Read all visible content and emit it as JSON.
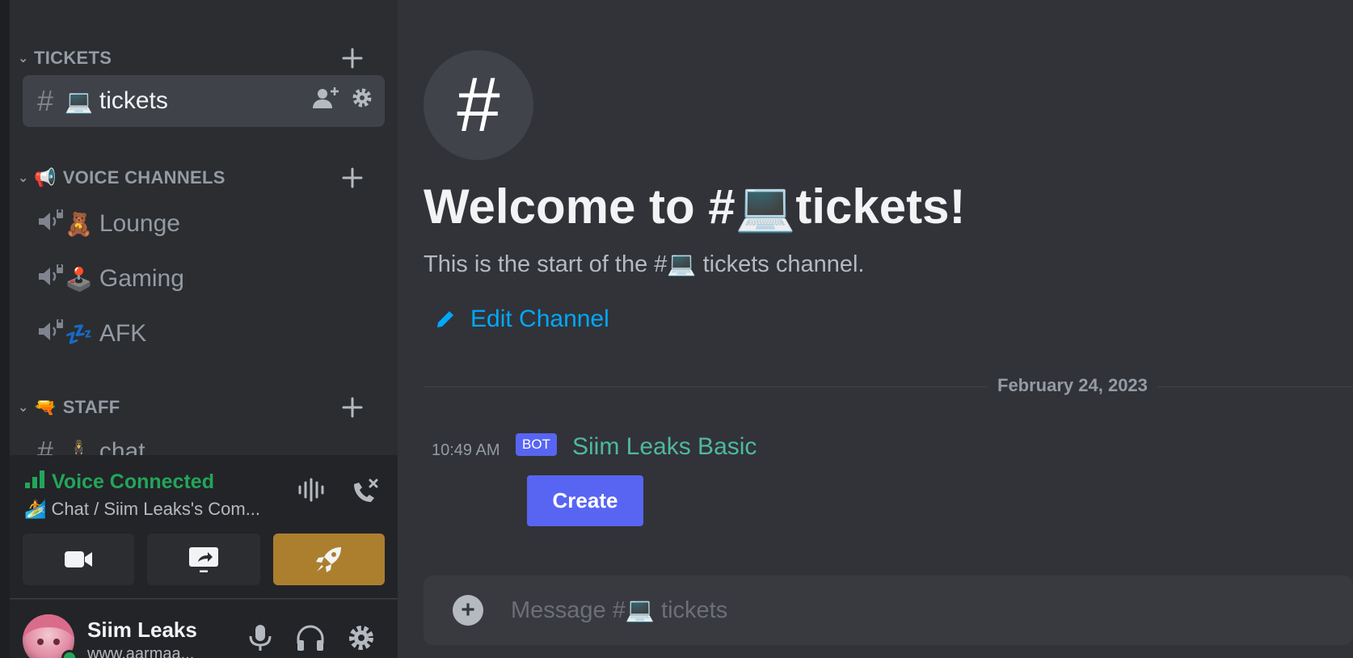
{
  "sidebar": {
    "categories": [
      {
        "label": "TICKETS",
        "emoji": ""
      },
      {
        "label": "VOICE CHANNELS",
        "emoji": "📢"
      },
      {
        "label": "STAFF",
        "emoji": "🔫"
      }
    ],
    "channels": {
      "tickets": {
        "emoji": "💻",
        "label": "tickets"
      },
      "lounge": {
        "emoji": "🧸",
        "label": "Lounge"
      },
      "gaming": {
        "emoji": "🕹️",
        "label": "Gaming"
      },
      "afk": {
        "emoji": "💤",
        "label": "AFK"
      },
      "chat": {
        "emoji": "🕴",
        "label": "chat"
      }
    }
  },
  "voice_panel": {
    "status": "Voice Connected",
    "location_emoji": "🏄",
    "location": "Chat / Siim Leaks's Com..."
  },
  "user": {
    "name": "Siim Leaks",
    "tag": "www.aarmaa..."
  },
  "main": {
    "welcome": "Welcome to #💻tickets!",
    "start_text": "This is the start of the #💻 tickets channel.",
    "edit_channel": "Edit Channel",
    "date_divider": "February 24, 2023",
    "message": {
      "timestamp": "10:49 AM",
      "badge": "BOT",
      "author": "Siim Leaks Basic",
      "button_label": "Create"
    },
    "composer": {
      "placeholder": "Message #💻 tickets"
    }
  },
  "colors": {
    "accent": "#5865f2",
    "link": "#00a8fc",
    "online": "#23a55a",
    "boost": "#ac7f2f",
    "author": "#4fb8a0"
  }
}
